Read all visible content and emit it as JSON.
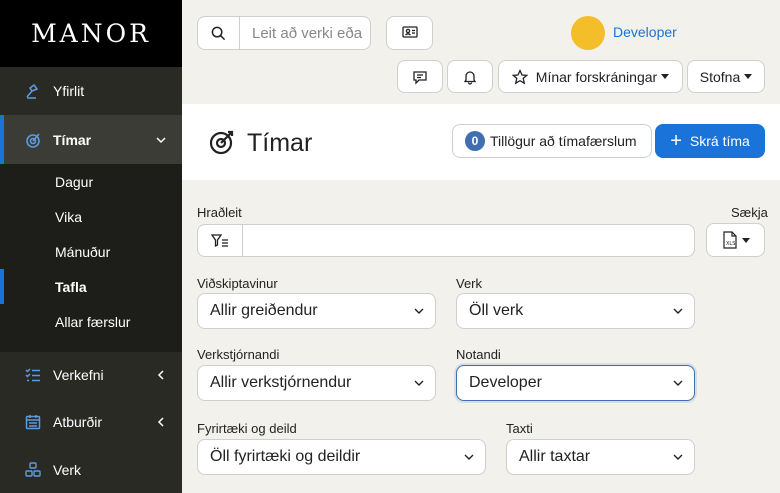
{
  "brand": "MANOR",
  "sidebar": {
    "items": [
      {
        "label": "Yfirlit",
        "icon": "overview-icon"
      },
      {
        "label": "Tímar",
        "icon": "timer-icon"
      },
      {
        "label": "Verkefni",
        "icon": "tasks-icon"
      },
      {
        "label": "Atburðir",
        "icon": "calendar-icon"
      },
      {
        "label": "Verk",
        "icon": "projects-icon"
      }
    ],
    "sub_items": [
      {
        "label": "Dagur"
      },
      {
        "label": "Vika"
      },
      {
        "label": "Mánuður"
      },
      {
        "label": "Tafla"
      },
      {
        "label": "Allar færslur"
      }
    ]
  },
  "topbar": {
    "search_placeholder": "Leit að verki eða",
    "user_name": "Developer",
    "bookmarks_label": "Mínar forskráningar",
    "create_label": "Stofna"
  },
  "header": {
    "title": "Tímar",
    "suggestions_count": "0",
    "suggestions_label": "Tillögur að tímafærslum",
    "register_label": "Skrá tíma"
  },
  "filters": {
    "quick_search_label": "Hraðleit",
    "quick_search_value": "",
    "export_label": "Sækja",
    "customer": {
      "label": "Viðskiptavinur",
      "value": "Allir greiðendur"
    },
    "project": {
      "label": "Verk",
      "value": "Öll verk"
    },
    "manager": {
      "label": "Verkstjórnandi",
      "value": "Allir verkstjórnendur"
    },
    "user": {
      "label": "Notandi",
      "value": "Developer"
    },
    "company": {
      "label": "Fyrirtæki og deild",
      "value": "Öll fyrirtæki og deildir"
    },
    "rate": {
      "label": "Taxti",
      "value": "Allir taxtar"
    }
  },
  "colors": {
    "accent": "#1a73d9",
    "sidebar_bg": "#2a2a25",
    "avatar": "#f4bd2a"
  }
}
